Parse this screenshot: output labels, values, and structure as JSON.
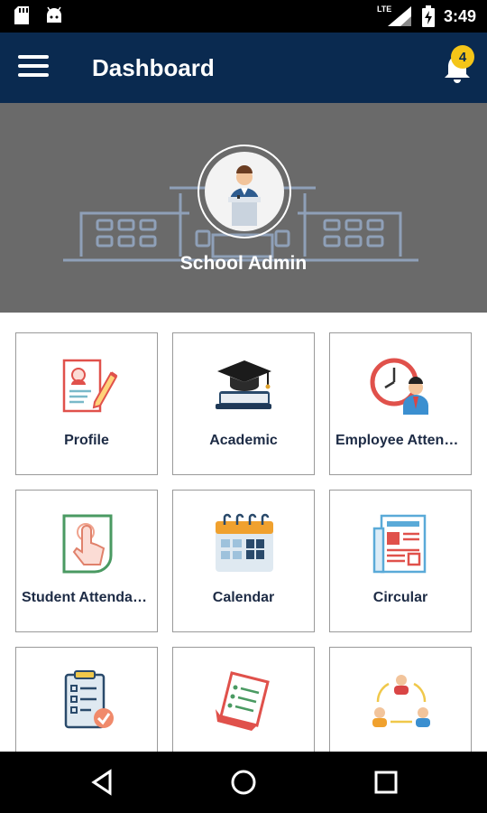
{
  "status_bar": {
    "time": "3:49",
    "network": "LTE",
    "icons": [
      "sd-card-icon",
      "android-icon",
      "signal-icon",
      "battery-charging-icon"
    ]
  },
  "app_bar": {
    "title": "Dashboard",
    "notification_count": "4",
    "menu_icon": "hamburger-menu-icon",
    "notification_icon": "bell-icon"
  },
  "profile": {
    "name": "School Admin",
    "avatar_icon": "speaker-at-podium-icon"
  },
  "colors": {
    "app_bar": "#0a2a50",
    "badge": "#f4c518",
    "banner": "#6a6a6a",
    "tile_label": "#1d2b45"
  },
  "tiles": [
    {
      "label": "Profile",
      "icon": "profile-card-icon"
    },
    {
      "label": "Academic",
      "icon": "graduation-cap-icon"
    },
    {
      "label": "Employee Attendance",
      "icon": "clock-employee-icon"
    },
    {
      "label": "Student Attendance",
      "icon": "touch-finger-icon"
    },
    {
      "label": "Calendar",
      "icon": "calendar-icon"
    },
    {
      "label": "Circular",
      "icon": "newspaper-icon"
    },
    {
      "label": "",
      "icon": "clipboard-check-icon"
    },
    {
      "label": "",
      "icon": "scroll-list-icon"
    },
    {
      "label": "",
      "icon": "team-cycle-icon"
    }
  ],
  "nav_bar": {
    "buttons": [
      "back-icon",
      "home-icon",
      "recents-icon"
    ]
  }
}
